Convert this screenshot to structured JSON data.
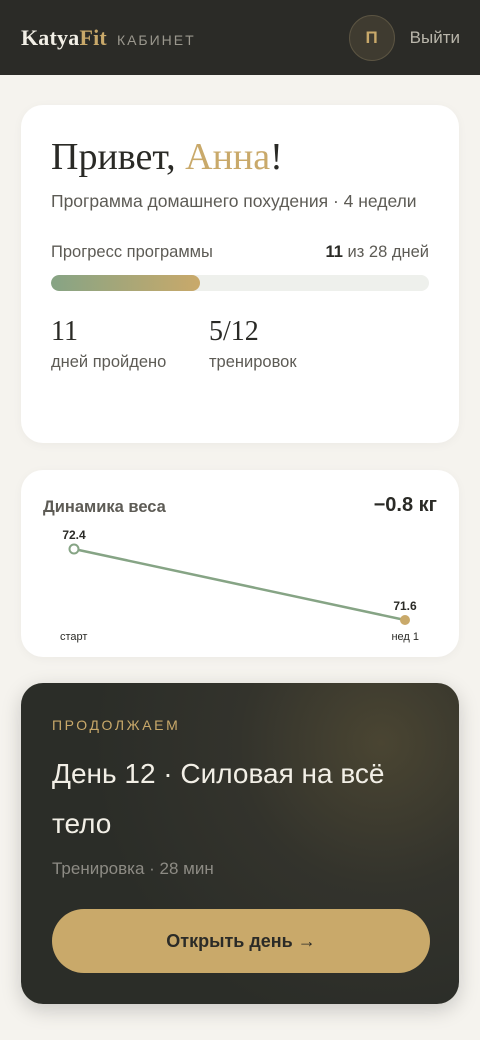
{
  "header": {
    "brand_main": "Katya",
    "brand_accent": "Fit",
    "section": "КАБИНЕТ",
    "avatar_initial": "П",
    "logout_label": "Выйти"
  },
  "welcome": {
    "greeting_prefix": "Привет, ",
    "name": "Анна",
    "greeting_suffix": "!",
    "program": "Программа домашнего похудения · 4 недели",
    "progress_label": "Прогресс программы",
    "progress_done": "11",
    "progress_total_text": " из 28 дней",
    "progress_fraction": 0.393,
    "stats": [
      {
        "value": "11",
        "label": "дней пройдено"
      },
      {
        "value": "5/12",
        "label": "тренировок"
      }
    ]
  },
  "weight": {
    "title": "Динамика веса",
    "delta": "−0.8 кг",
    "points": [
      {
        "value": 72.4,
        "label": "72.4",
        "tick": "старт"
      },
      {
        "value": 71.6,
        "label": "71.6",
        "tick": "нед 1"
      }
    ]
  },
  "continue": {
    "kicker": "ПРОДОЛЖАЕМ",
    "title": "День 12 · Силовая на всё тело",
    "meta": "Тренировка · 28 мин",
    "button_label": "Открыть день →"
  },
  "colors": {
    "accent": "#c9a96a",
    "sage": "#86a485",
    "dark": "#2b2b27"
  }
}
